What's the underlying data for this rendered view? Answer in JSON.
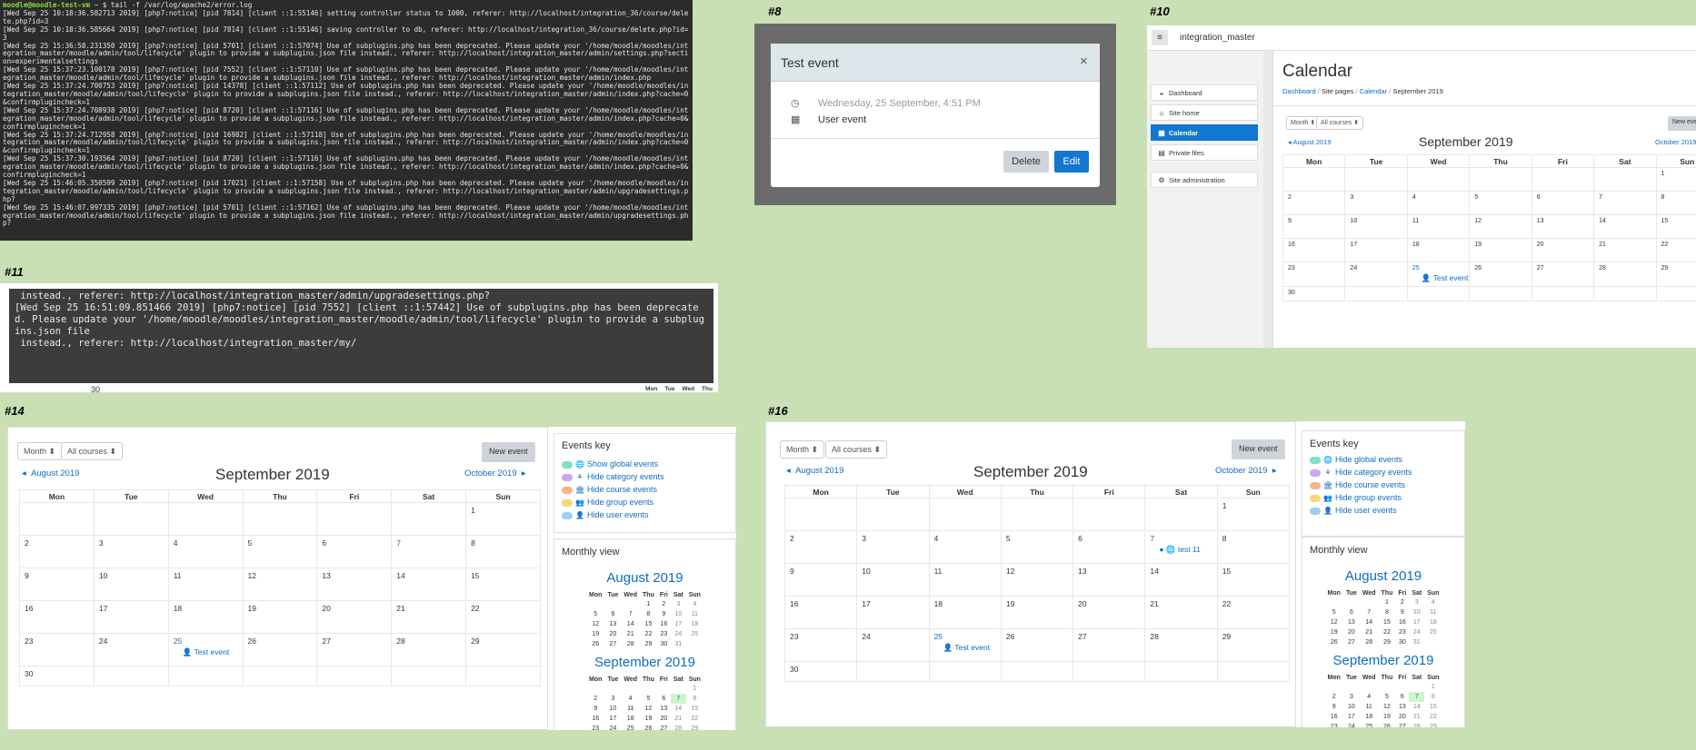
{
  "labels": {
    "s8": "#8",
    "s10": "#10",
    "s11": "#11",
    "s14": "#14",
    "s16": "#16"
  },
  "terminal1": {
    "prompt": "moodle@moodle-test-vm",
    "command": "~ $ tail -f /var/log/apache2/error.log",
    "lines": [
      "[Wed Sep 25 10:18:36.582713 2019] [php7:notice] [pid 7814] [client ::1:55146] setting controller status to 1000, referer: http://localhost/integration_36/course/delete.php?id=3",
      "[Wed Sep 25 10:18:36.585664 2019] [php7:notice] [pid 7814] [client ::1:55146] saving controller to db, referer: http://localhost/integration_36/course/delete.php?id=3",
      "[Wed Sep 25 15:36:58.231350 2019] [php7:notice] [pid 5701] [client ::1:57074] Use of subplugins.php has been deprecated. Please update your '/home/moodle/moodles/integration_master/moodle/admin/tool/lifecycle' plugin to provide a subplugins.json file instead., referer: http://localhost/integration_master/admin/settings.php?section=experimentalsettings",
      "[Wed Sep 25 15:37:23.100178 2019] [php7:notice] [pid 7552] [client ::1:57110] Use of subplugins.php has been deprecated. Please update your '/home/moodle/moodles/integration_master/moodle/admin/tool/lifecycle' plugin to provide a subplugins.json file instead., referer: http://localhost/integration_master/admin/index.php",
      "[Wed Sep 25 15:37:24.700753 2019] [php7:notice] [pid 14378] [client ::1:57112] Use of subplugins.php has been deprecated. Please update your '/home/moodle/moodles/integration_master/moodle/admin/tool/lifecycle' plugin to provide a subplugins.json file instead., referer: http://localhost/integration_master/admin/index.php?cache=0&confirmplugincheck=1",
      "[Wed Sep 25 15:37:24.708938 2019] [php7:notice] [pid 8720] [client ::1:57116] Use of subplugins.php has been deprecated. Please update your '/home/moodle/moodles/integration_master/moodle/admin/tool/lifecycle' plugin to provide a subplugins.json file instead., referer: http://localhost/integration_master/admin/index.php?cache=0&confirmplugincheck=1",
      "[Wed Sep 25 15:37:24.712958 2019] [php7:notice] [pid 16982] [client ::1:57118] Use of subplugins.php has been deprecated. Please update your '/home/moodle/moodles/integration_master/moodle/admin/tool/lifecycle' plugin to provide a subplugins.json file instead., referer: http://localhost/integration_master/admin/index.php?cache=0&confirmplugincheck=1",
      "[Wed Sep 25 15:37:30.193564 2019] [php7:notice] [pid 8720] [client ::1:57116] Use of subplugins.php has been deprecated. Please update your '/home/moodle/moodles/integration_master/moodle/admin/tool/lifecycle' plugin to provide a subplugins.json file instead., referer: http://localhost/integration_master/admin/index.php?cache=0&confirmplugincheck=1",
      "[Wed Sep 25 15:46:05.350599 2019] [php7:notice] [pid 17021] [client ::1:57158] Use of subplugins.php has been deprecated. Please update your '/home/moodle/moodles/integration_master/moodle/admin/tool/lifecycle' plugin to provide a subplugins.json file instead., referer: http://localhost/integration_master/admin/upgradesettings.php?",
      "[Wed Sep 25 15:46:07.997335 2019] [php7:notice] [pid 5701] [client ::1:57162] Use of subplugins.php has been deprecated. Please update your '/home/moodle/moodles/integration_master/moodle/admin/tool/lifecycle' plugin to provide a subplugins.json file instead., referer: http://localhost/integration_master/admin/upgradesettings.php?"
    ]
  },
  "terminal2": {
    "lines": [
      " instead., referer: http://localhost/integration_master/admin/upgradesettings.php?",
      "[Wed Sep 25 16:51:09.851466 2019] [php7:notice] [pid 7552] [client ::1:57442] Use of subplugins.php has been deprecated. Please update your '/home/moodle/moodles/integration_master/moodle/admin/tool/lifecycle' plugin to provide a subplugins.json file",
      " instead., referer: http://localhost/integration_master/my/"
    ],
    "below_left": "30",
    "below_right": [
      "Mon",
      "Tue",
      "Wed",
      "Thu"
    ]
  },
  "modal": {
    "title": "Test event",
    "close": "×",
    "date": "Wednesday, 25 September, 4:51 PM",
    "type": "User event",
    "delete": "Delete",
    "edit": "Edit"
  },
  "s10": {
    "site": "integration_master",
    "page_title": "Calendar",
    "breadcrumb": [
      "Dashboard",
      "Site pages",
      "Calendar",
      "September 2019"
    ],
    "nav": [
      {
        "label": "Dashboard"
      },
      {
        "label": "Site home"
      },
      {
        "label": "Calendar"
      },
      {
        "label": "Private files"
      },
      {
        "label": "Site administration"
      }
    ],
    "view": "Month",
    "course": "All courses",
    "new_event": "New event",
    "prev": "August 2019",
    "next": "October 2019",
    "month": "September 2019",
    "event": "Test event"
  },
  "weekdays": [
    "Mon",
    "Tue",
    "Wed",
    "Thu",
    "Fri",
    "Sat",
    "Sun"
  ],
  "mini_days": [
    "Mon",
    "Tue",
    "Wed",
    "Thu",
    "Fri",
    "Sat",
    "Sun"
  ],
  "s14": {
    "view": "Month",
    "course": "All courses",
    "new_event": "New event",
    "prev": "August 2019",
    "next": "October 2019",
    "month": "September 2019",
    "event": "Test event",
    "key_title": "Events key",
    "keys": [
      "Show global events",
      "Hide category events",
      "Hide course events",
      "Hide group events",
      "Hide user events"
    ],
    "monthly_title": "Monthly view",
    "mini1": "August 2019",
    "mini2": "September 2019"
  },
  "s16": {
    "view": "Month",
    "course": "All courses",
    "new_event": "New event",
    "prev": "August 2019",
    "next": "October 2019",
    "month": "September 2019",
    "event": "Test event",
    "event7": "test 11",
    "key_title": "Events key",
    "keys": [
      "Hide global events",
      "Hide category events",
      "Hide course events",
      "Hide group events",
      "Hide user events"
    ],
    "monthly_title": "Monthly view",
    "mini1": "August 2019",
    "mini2": "September 2019"
  },
  "colors": {
    "link": "#0f6cbf",
    "primary": "#1177d1",
    "bg": "#c9e0b5"
  }
}
